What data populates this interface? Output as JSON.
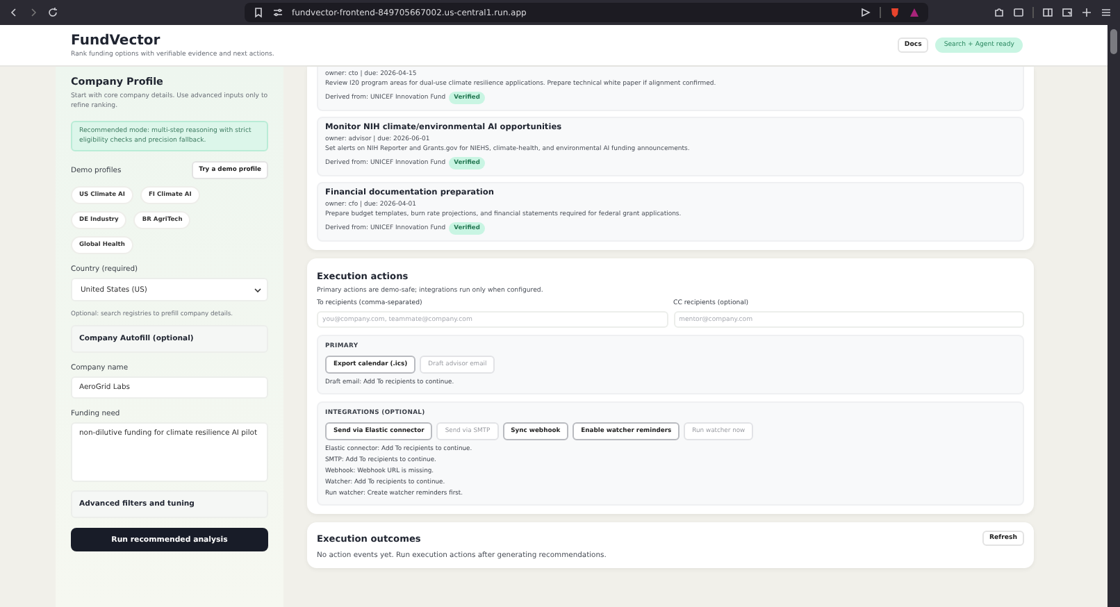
{
  "browser": {
    "url": "fundvector-frontend-849705667002.us-central1.run.app"
  },
  "header": {
    "title": "FundVector",
    "subtitle": "Rank funding options with verifiable evidence and next actions.",
    "docs_button": "Docs",
    "status_badge": "Search + Agent ready"
  },
  "sidebar": {
    "title": "Company Profile",
    "intro": "Start with core company details. Use advanced inputs only to refine ranking.",
    "note": "Recommended mode: multi-step reasoning with strict eligibility checks and precision fallback.",
    "demo_label": "Demo profiles",
    "demo_button": "Try a demo profile",
    "demo_chips": [
      "US Climate AI",
      "FI Climate AI",
      "DE Industry",
      "BR AgriTech",
      "Global Health"
    ],
    "country_label": "Country (required)",
    "country_value": "United States (US)",
    "registry_hint": "Optional: search registries to prefill company details.",
    "autofill_section": "Company Autofill (optional)",
    "company_name_label": "Company name",
    "company_name_value": "AeroGrid Labs",
    "funding_need_label": "Funding need",
    "funding_need_value": "non-dilutive funding for climate resilience AI pilot",
    "advanced_section": "Advanced filters and tuning",
    "run_button": "Run recommended analysis"
  },
  "action_items": [
    {
      "meta": "owner: cto | due: 2026-04-15",
      "description": "Review I20 program areas for dual-use climate resilience applications. Prepare technical white paper if alignment confirmed.",
      "source": "Derived from: UNICEF Innovation Fund",
      "badge": "Verified"
    },
    {
      "title": "Monitor NIH climate/environmental AI opportunities",
      "meta": "owner: advisor | due: 2026-06-01",
      "description": "Set alerts on NIH Reporter and Grants.gov for NIEHS, climate-health, and environmental AI funding announcements.",
      "source": "Derived from: UNICEF Innovation Fund",
      "badge": "Verified"
    },
    {
      "title": "Financial documentation preparation",
      "meta": "owner: cfo | due: 2026-04-01",
      "description": "Prepare budget templates, burn rate projections, and financial statements required for federal grant applications.",
      "source": "Derived from: UNICEF Innovation Fund",
      "badge": "Verified"
    }
  ],
  "execution": {
    "title": "Execution actions",
    "subtitle": "Primary actions are demo-safe; integrations run only when configured.",
    "to_label": "To recipients (comma-separated)",
    "to_placeholder": "you@company.com, teammate@company.com",
    "cc_label": "CC recipients (optional)",
    "cc_placeholder": "mentor@company.com",
    "groups": [
      {
        "heading": "PRIMARY",
        "buttons": [
          {
            "label": "Export calendar (.ics)",
            "disabled": false
          },
          {
            "label": "Draft advisor email",
            "disabled": true
          }
        ],
        "messages": [
          "Draft email: Add To recipients to continue."
        ]
      },
      {
        "heading": "INTEGRATIONS (OPTIONAL)",
        "buttons": [
          {
            "label": "Send via Elastic connector",
            "disabled": false
          },
          {
            "label": "Send via SMTP",
            "disabled": true
          },
          {
            "label": "Sync webhook",
            "disabled": false
          },
          {
            "label": "Enable watcher reminders",
            "disabled": false
          },
          {
            "label": "Run watcher now",
            "disabled": true
          }
        ],
        "messages": [
          "Elastic connector: Add To recipients to continue.",
          "SMTP: Add To recipients to continue.",
          "Webhook: Webhook URL is missing.",
          "Watcher: Add To recipients to continue.",
          "Run watcher: Create watcher reminders first."
        ]
      }
    ]
  },
  "outcomes": {
    "title": "Execution outcomes",
    "refresh_button": "Refresh",
    "empty_text": "No action events yet. Run execution actions after generating recommendations."
  }
}
